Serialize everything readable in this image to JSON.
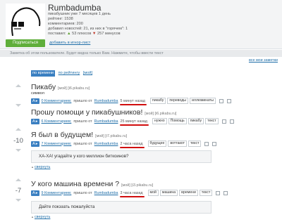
{
  "profile": {
    "username": "Rumbadumba",
    "on_site": "пикабушник уже 7 месяцев 1 день",
    "rating": "рейтинг: 1538",
    "comments": "комментариев: 200",
    "posts": "добавил новостей: 21, из них в \"горячем\": 1",
    "ratings_given": "поставил: ",
    "pluses": "53 плюсов",
    "minuses": "257 минусов",
    "subscribe_button": "Подписаться",
    "ignore_link": "добавить в игнор-лист"
  },
  "note": {
    "text": "Заметка об этом пользователе. Будет видна только Вам. Нажмите, чтобы ввести текст",
    "all_notes": "все мои заметки"
  },
  "sort": {
    "active": "по времени",
    "by_rating": "по рейтингу",
    "mine": "[мой]"
  },
  "posts": [
    {
      "title": "Пикабу",
      "meta": "[мой] [i6.pikabu.ru]",
      "body": "символ",
      "comments": "0 Комментариев;",
      "sent_from": "пришло от",
      "author": "Rumbadumba",
      "time": "5 минут назад",
      "tags": [
        "пикабу",
        "переводы",
        "иллюминаты"
      ]
    },
    {
      "title": "Прошу помощи у пикабушников!",
      "meta": "[мой] [i6.pikabu.ru]",
      "comments": "6 Комментариев;",
      "sent_from": "пришло от",
      "author": "Rumbadumba",
      "time": "25 минут назад",
      "tags": [
        "нужно",
        "Помощь",
        "пикабу",
        "текст"
      ]
    },
    {
      "title": "Я был в будущем!",
      "meta": "[мой] [i7.pikabu.ru]",
      "rating": "-10",
      "comments": "7 Комментариев;",
      "sent_from": "пришло от",
      "author": "Rumbadumba",
      "time": "2 часа назад",
      "tags": [
        "будущее",
        "воттакот",
        "текст"
      ],
      "comment_text": "ХА-ХА! угадайте у кого миллион биткоинов?",
      "collapse": "свернуть"
    },
    {
      "title": "У кого машина времени ?",
      "meta": "[мой] [i3.pikabu.ru]",
      "rating": "-7",
      "comments": "9 Комментариев;",
      "sent_from": "пришло от",
      "author": "Rumbadumba",
      "time": "3 часа назад",
      "tags": [
        "мой",
        "машина",
        "времени",
        "текст"
      ],
      "comment_text": "Дайте покэзать пожалуйста",
      "collapse": "свернуть"
    }
  ],
  "colors": {
    "accent": "#3a7fc1",
    "underline": "#d10d0d",
    "subscribe": "#5fae3a"
  }
}
